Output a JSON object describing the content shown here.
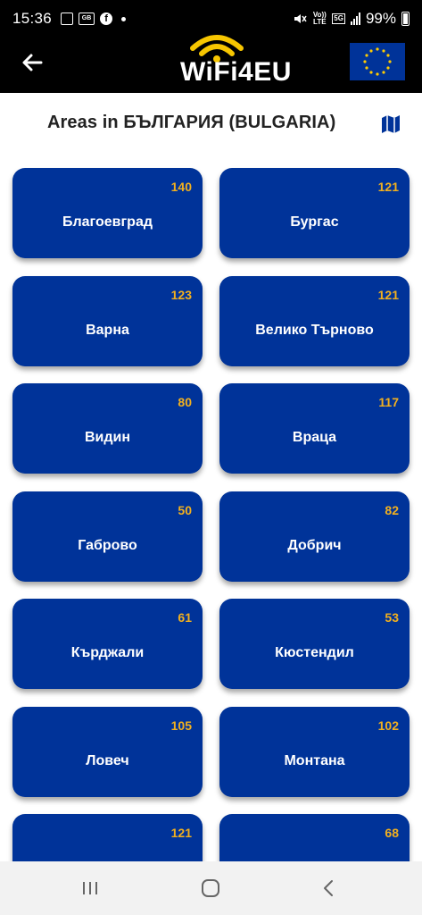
{
  "status_bar": {
    "time": "15:36",
    "notification_icons": [
      "gallery-icon",
      "gb-icon",
      "facebook-icon",
      "dot-icon"
    ],
    "gb_label": "GB",
    "facebook_label": "f",
    "network": "5G",
    "volte": "Vo)) LTE",
    "battery": "99%"
  },
  "app_bar": {
    "logo_text": "WiFi4EU"
  },
  "page": {
    "title": "Areas in БЪЛГАРИЯ (BULGARIA)"
  },
  "areas": [
    {
      "name": "Благоевград",
      "count": "140"
    },
    {
      "name": "Бургас",
      "count": "121"
    },
    {
      "name": "Варна",
      "count": "123"
    },
    {
      "name": "Велико Търново",
      "count": "121"
    },
    {
      "name": "Видин",
      "count": "80"
    },
    {
      "name": "Враца",
      "count": "117"
    },
    {
      "name": "Габрово",
      "count": "50"
    },
    {
      "name": "Добрич",
      "count": "82"
    },
    {
      "name": "Кърджали",
      "count": "61"
    },
    {
      "name": "Кюстендил",
      "count": "53"
    },
    {
      "name": "Ловеч",
      "count": "105"
    },
    {
      "name": "Монтана",
      "count": "102"
    },
    {
      "name": "",
      "count": "121"
    },
    {
      "name": "",
      "count": "68"
    }
  ],
  "colors": {
    "card": "#003399",
    "count": "#f2b01e",
    "logo_accent": "#f7c600",
    "eu_star": "#ffcc00"
  }
}
